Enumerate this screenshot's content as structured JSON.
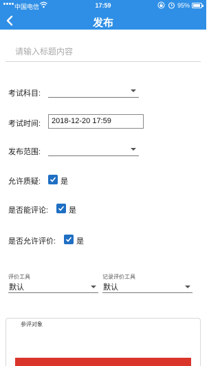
{
  "status_bar": {
    "carrier": "中国电信",
    "time": "17:59",
    "battery": "95%",
    "battery_level": 0.95,
    "icons": [
      "signal-icon",
      "wifi-icon",
      "lock-rotation-icon",
      "alarm-icon",
      "battery-icon"
    ]
  },
  "nav": {
    "title": "发布",
    "back_icon": "chevron-left-icon"
  },
  "title_field": {
    "placeholder": "请输入标题内容",
    "value": ""
  },
  "form": {
    "subject_label": "考试科目:",
    "subject_value": "",
    "time_label": "考试时间:",
    "time_value": "2018-12-20 17:59",
    "scope_label": "发布范围:",
    "scope_value": "",
    "allow_question_label": "允许质疑:",
    "allow_question_checked": true,
    "allow_comment_label": "是否能评论:",
    "allow_comment_checked": true,
    "allow_evaluation_label": "是否允许评价:",
    "allow_evaluation_checked": true,
    "yes_label": "是"
  },
  "tools": {
    "eval_tool_label": "评价工具",
    "eval_tool_value": "默认",
    "record_tool_label": "记录评价工具",
    "record_tool_value": "默认"
  },
  "participants": {
    "legend": "参评对象"
  },
  "colors": {
    "primary": "#2f8fe6",
    "checkbox": "#1f6fc3",
    "submit": "#d9352b"
  }
}
